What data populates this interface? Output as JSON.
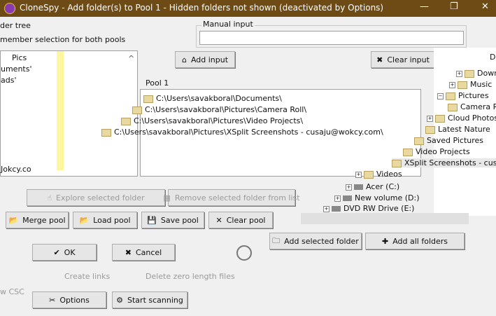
{
  "window": {
    "title": "CloneSpy - Add folder(s) to Pool 1 - Hidden folders not shown (deactivated by Options)",
    "minimize": "—",
    "maximize": "❐",
    "close": "✕"
  },
  "left": {
    "group_label": "der tree",
    "remember": "member selection for both pools",
    "items": [
      "Pics",
      "uments'",
      "ads'"
    ],
    "partial": "Jokcy.co"
  },
  "manual": {
    "label": "Manual input",
    "value": "",
    "add": "Add input",
    "clear": "Clear input"
  },
  "pool": {
    "label": "Pool 1",
    "items": [
      "C:\\Users\\savakboral\\Documents\\",
      "C:\\Users\\savakboral\\Pictures\\Camera Roll\\",
      "C:\\Users\\savakboral\\Pictures\\Video Projects\\",
      "C:\\Users\\savakboral\\Pictures\\XSplit Screenshots - cusaju@wokcy.com\\"
    ]
  },
  "tree": {
    "items": [
      "D",
      "Down",
      "Music",
      "Pictures",
      "Camera Ro",
      "Cloud Photos",
      "Latest Nature",
      "Saved Pictures",
      "Video Projects",
      "XSplit Screenshots - cusaju",
      "Videos",
      "Acer (C:)",
      "New volume (D:)",
      "DVD RW Drive (E:)"
    ]
  },
  "buttons": {
    "explore": "Explore selected folder",
    "remove": "Remove selected folder from list",
    "merge": "Merge pool",
    "load": "Load pool",
    "save": "Save pool",
    "clear_pool": "Clear pool",
    "ok": "OK",
    "cancel": "Cancel",
    "add_selected": "Add selected folder",
    "add_all": "Add all folders",
    "create_links": "Create links",
    "delete_zero": "Delete zero length files",
    "options": "Options",
    "start": "Start scanning",
    "csc": "w CSC"
  }
}
